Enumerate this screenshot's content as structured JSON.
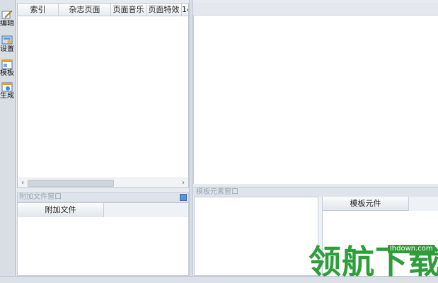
{
  "toolbar": {
    "items": [
      {
        "label": "编辑",
        "icon": "edit-icon"
      },
      {
        "label": "设置",
        "icon": "settings-icon"
      },
      {
        "label": "模板",
        "icon": "template-icon"
      },
      {
        "label": "生成",
        "icon": "build-icon"
      }
    ]
  },
  "list": {
    "columns": [
      "索引",
      "杂志页面",
      "页面音乐",
      "页面特效",
      "14"
    ]
  },
  "attach": {
    "title": "附加文件窗口",
    "column": "附加文件"
  },
  "template": {
    "title": "模板元素窗口",
    "column": "模板元件"
  },
  "watermark": {
    "url": "lhdown.com",
    "text": "领航下载"
  },
  "colors": {
    "accent": "#5b8fd8",
    "watermark": "#2e9e3a"
  }
}
